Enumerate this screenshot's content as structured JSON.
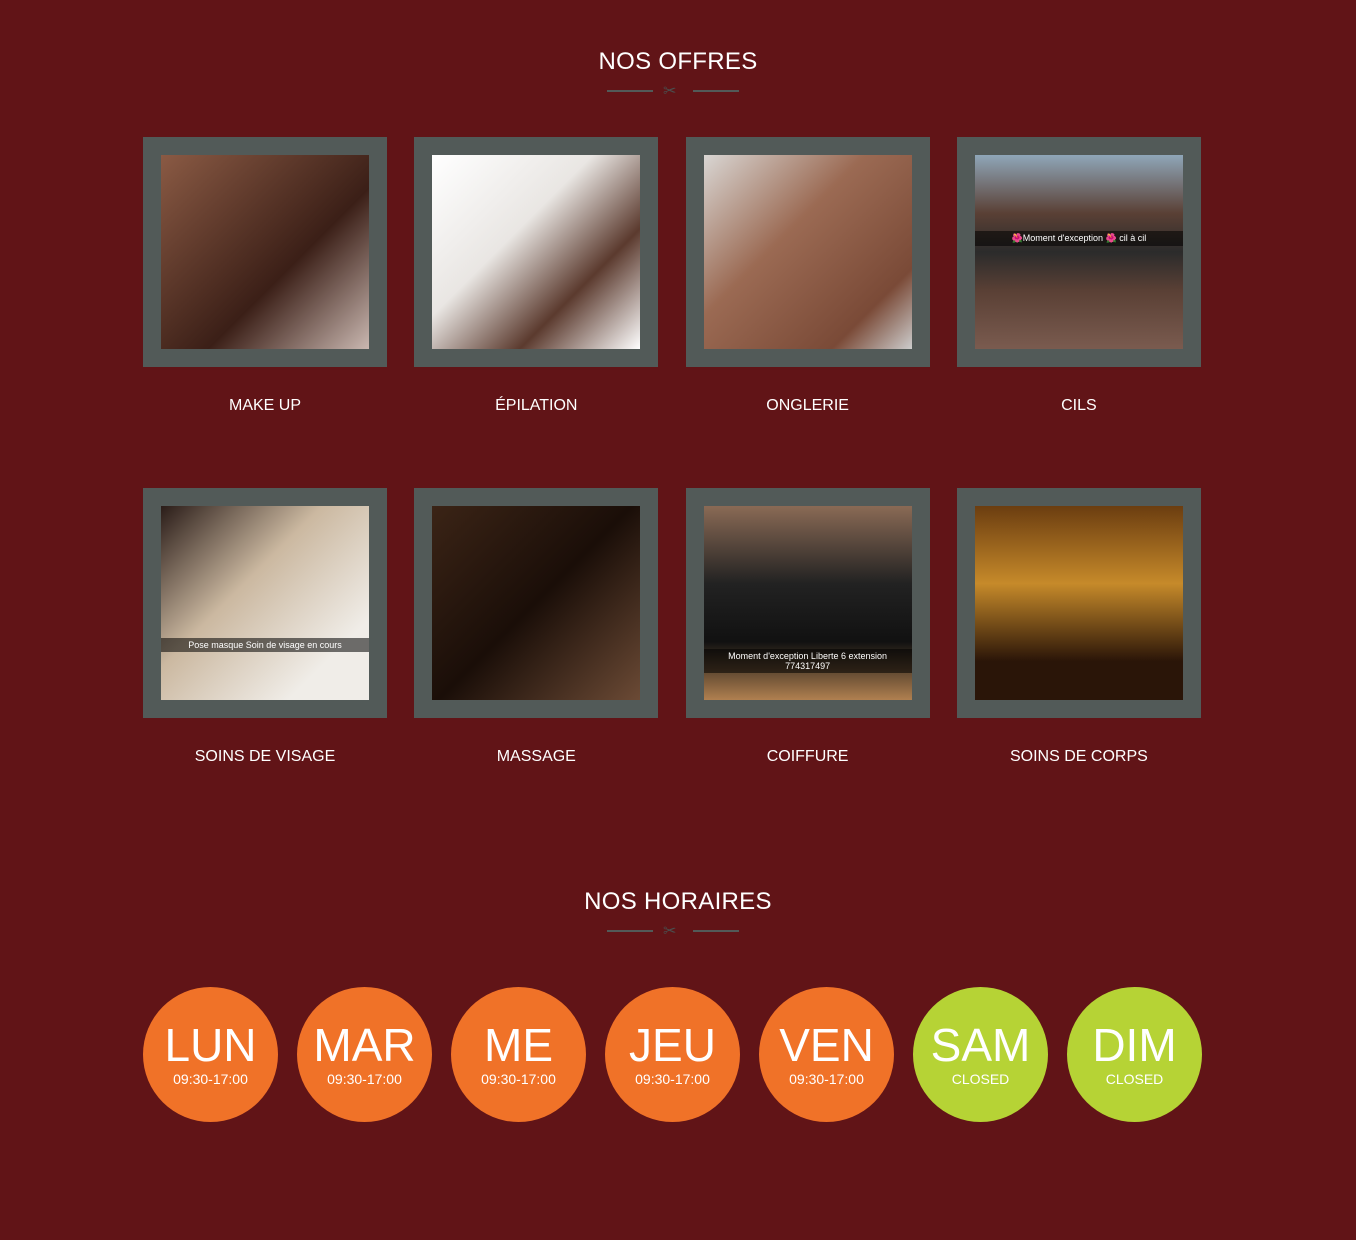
{
  "offers": {
    "title": "NOS OFFRES",
    "items": [
      {
        "label": "MAKE UP",
        "caption": ""
      },
      {
        "label": "ÉPILATION",
        "caption": ""
      },
      {
        "label": "ONGLERIE",
        "caption": ""
      },
      {
        "label": "CILS",
        "caption": "🌺Moment d'exception 🌺 cil à cil"
      },
      {
        "label": "SOINS DE VISAGE",
        "caption": "Pose masque Soin de visage en cours"
      },
      {
        "label": "MASSAGE",
        "caption": ""
      },
      {
        "label": "COIFFURE",
        "caption": "Moment d'exception Liberte 6 extension 774317497"
      },
      {
        "label": "SOINS DE CORPS",
        "caption": ""
      }
    ]
  },
  "hours": {
    "title": "NOS HORAIRES",
    "days": [
      {
        "day": "LUN",
        "hours": "09:30-17:00"
      },
      {
        "day": "MAR",
        "hours": "09:30-17:00"
      },
      {
        "day": "ME",
        "hours": "09:30-17:00"
      },
      {
        "day": "JEU",
        "hours": "09:30-17:00"
      },
      {
        "day": "VEN",
        "hours": "09:30-17:00"
      },
      {
        "day": "SAM",
        "hours": "CLOSED"
      },
      {
        "day": "DIM",
        "hours": "CLOSED"
      }
    ]
  },
  "colors": {
    "background": "#611417",
    "open": "#f07228",
    "closed": "#b6d335",
    "frame": "#525a58"
  }
}
